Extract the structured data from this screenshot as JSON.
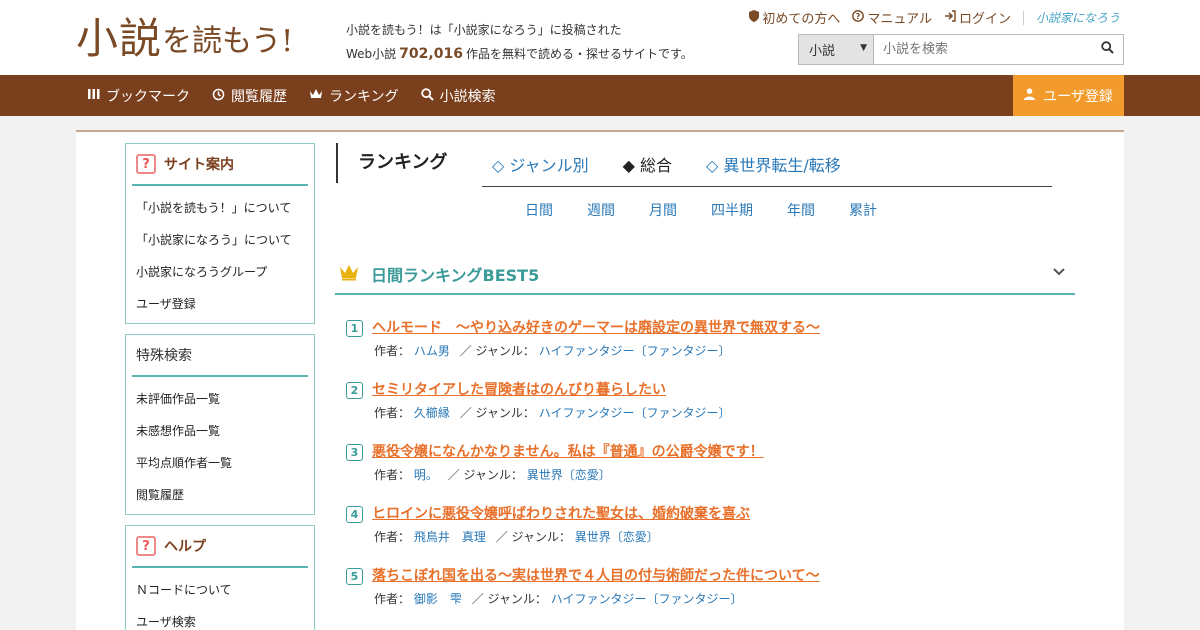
{
  "header": {
    "logo_main": "小説",
    "logo_sub": "を読もう!",
    "tagline_line1": "小説を読もう！は「小説家になろう」に投稿された",
    "tagline_prefix": "Web小説",
    "tagline_count": "702,016",
    "tagline_suffix": "作品を無料で読める・探せるサイトです。",
    "top_links": [
      {
        "label": "初めての方へ",
        "icon": "shield-icon"
      },
      {
        "label": "マニュアル",
        "icon": "help-circle-icon"
      },
      {
        "label": "ログイン",
        "icon": "login-icon"
      }
    ],
    "partner_logo": "小説家になろう",
    "search": {
      "select_value": "小説",
      "placeholder": "小説を検索"
    }
  },
  "nav": {
    "items": [
      {
        "label": "ブックマーク",
        "icon": "bookmark-icon"
      },
      {
        "label": "閲覧履歴",
        "icon": "history-icon"
      },
      {
        "label": "ランキング",
        "icon": "crown-icon"
      },
      {
        "label": "小説検索",
        "icon": "search-icon"
      }
    ],
    "register_label": "ユーザ登録"
  },
  "sidebar": {
    "site_guide": {
      "title": "サイト案内",
      "items": [
        "「小説を読もう！」について",
        "「小説家になろう」について",
        "小説家になろうグループ",
        "ユーザ登録"
      ]
    },
    "special_search": {
      "title": "特殊検索",
      "items": [
        "未評価作品一覧",
        "未感想作品一覧",
        "平均点順作者一覧",
        "閲覧履歴"
      ]
    },
    "help": {
      "title": "ヘルプ",
      "items": [
        "Ｎコードについて",
        "ユーザ検索"
      ]
    }
  },
  "ranking": {
    "title": "ランキング",
    "tabs": [
      {
        "label": "◇ ジャンル別",
        "active": false
      },
      {
        "label": "◆ 総合",
        "active": true
      },
      {
        "label": "◇ 異世界転生/転移",
        "active": false
      }
    ],
    "periods": [
      "日間",
      "週間",
      "月間",
      "四半期",
      "年間",
      "累計"
    ],
    "best_title": "日間ランキングBEST5",
    "author_label": "作者：",
    "genre_label": "／ ジャンル：",
    "items": [
      {
        "rank": "1",
        "title": "ヘルモード　～やり込み好きのゲーマーは廃設定の異世界で無双する～",
        "author": "ハム男",
        "genre": "ハイファンタジー〔ファンタジー〕"
      },
      {
        "rank": "2",
        "title": "セミリタイアした冒険者はのんびり暮らしたい",
        "author": "久櫛縁",
        "genre": "ハイファンタジー〔ファンタジー〕"
      },
      {
        "rank": "3",
        "title": "悪役令嬢になんかなりません。私は『普通』の公爵令嬢です！",
        "author": "明。",
        "genre": "異世界〔恋愛〕"
      },
      {
        "rank": "4",
        "title": "ヒロインに悪役令嬢呼ばわりされた聖女は、婚約破棄を喜ぶ",
        "author": "飛鳥井　真理",
        "genre": "異世界〔恋愛〕"
      },
      {
        "rank": "5",
        "title": "落ちこぼれ国を出る～実は世界で４人目の付与術師だった件について～",
        "author": "御影　雫",
        "genre": "ハイファンタジー〔ファンタジー〕"
      }
    ]
  }
}
